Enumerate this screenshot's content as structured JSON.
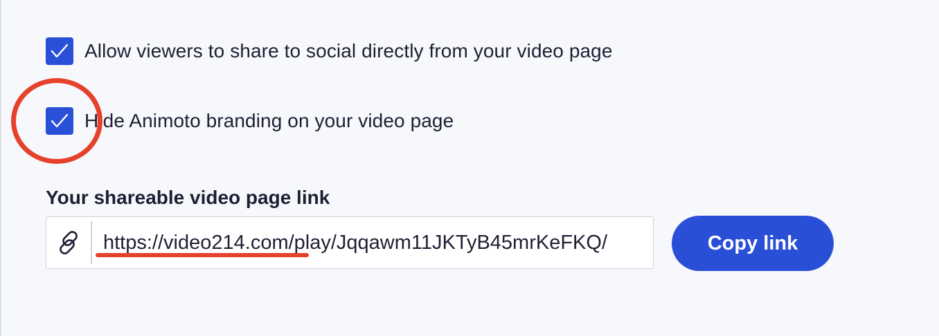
{
  "options": [
    {
      "label": "Allow viewers to share to social directly from your video page",
      "checked": true
    },
    {
      "label": "Hide Animoto branding on your video page",
      "checked": true
    }
  ],
  "share": {
    "title": "Your shareable video page link",
    "url": "https://video214.com/play/Jqqawm11JKTyB45mrKeFKQ/",
    "copy_label": "Copy link"
  },
  "icons": {
    "checkbox": "check-icon",
    "link": "link-icon"
  },
  "colors": {
    "accent": "#2a50d8",
    "annotation": "#e5412b",
    "background": "#f7f8fc",
    "text": "#1e1f33"
  }
}
